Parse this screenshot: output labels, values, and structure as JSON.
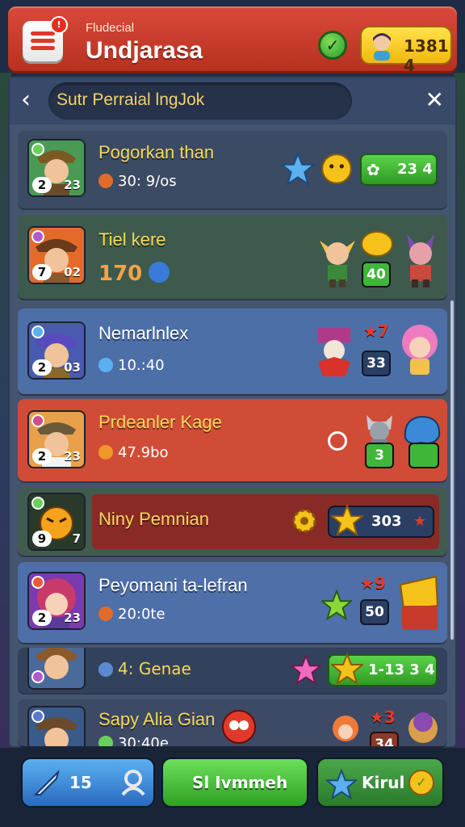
{
  "header": {
    "subtitle": "Fludecial",
    "title": "Undjarasa",
    "menu_badge": "!",
    "coins": "1381 4",
    "check_symbol": "✓"
  },
  "search": {
    "placeholder": "Sutr Perraial lngJok",
    "back_symbol": "‹",
    "close_symbol": "✕"
  },
  "rows": [
    {
      "name": "Pogorkan than",
      "stat": "30: 9/os",
      "lvl_left": "2",
      "lvl_right": "23",
      "pill": "23 4",
      "color": "#3b4b63"
    },
    {
      "name": "Tiel kere",
      "stat": "170",
      "lvl_left": "7",
      "lvl_right": "02",
      "chip": "40",
      "color": "#3d5a4d"
    },
    {
      "name": "Nemarlnlex",
      "stat": "10.:40",
      "lvl_left": "2",
      "lvl_right": "03",
      "chip": "33",
      "rank": "★7",
      "color": "#4c6fa8"
    },
    {
      "name": "Prdeanler Kage",
      "stat": "47.9bo",
      "lvl_left": "2",
      "lvl_right": "23",
      "chip": "3",
      "color": "#d04c36"
    },
    {
      "name": "Niny Pemnian",
      "lvl_left": "9",
      "lvl_right": "7",
      "pill": "303",
      "color": "#415c4e"
    },
    {
      "name": "Peyomani ta-lefran",
      "stat": "20:0te",
      "lvl_left": "2",
      "lvl_right": "23",
      "chip": "50",
      "rank": "★9",
      "color": "#4f6fa8"
    },
    {
      "name": "4: Genae",
      "pill": "1-13 3 4",
      "color": "#33425c"
    },
    {
      "name": "Sapy Alia Gian",
      "stat": "30:40e",
      "rank": "★3",
      "chip": "34",
      "color": "#3d4a66"
    }
  ],
  "bottom": {
    "left_label": "15",
    "center_label": "Sl Ivmmeh",
    "right_label": "Kirul"
  },
  "colors": {
    "header_red": "#c63a27",
    "accent_green": "#3fbf3a",
    "gold": "#f4c21a"
  }
}
